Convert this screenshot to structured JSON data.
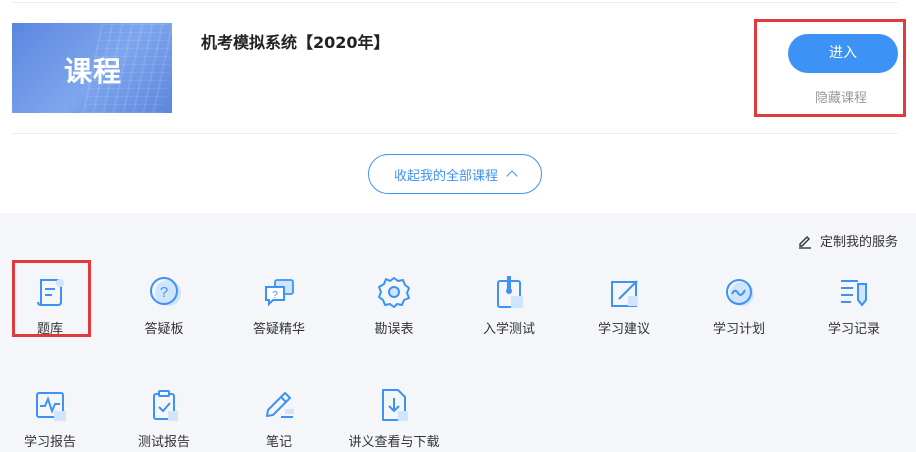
{
  "course": {
    "thumbnail_text": "课程",
    "title": "机考模拟系统【2020年】",
    "enter_label": "进入",
    "hide_label": "隐藏课程"
  },
  "collapse": {
    "label": "收起我的全部课程"
  },
  "services": {
    "customize_label": "定制我的服务",
    "items": [
      {
        "label": "题库",
        "icon": "question-bank-icon"
      },
      {
        "label": "答疑板",
        "icon": "question-mark-icon"
      },
      {
        "label": "答疑精华",
        "icon": "chat-bubbles-icon"
      },
      {
        "label": "勘误表",
        "icon": "gear-icon"
      },
      {
        "label": "入学测试",
        "icon": "clipboard-pin-icon"
      },
      {
        "label": "学习建议",
        "icon": "edit-box-icon"
      },
      {
        "label": "学习计划",
        "icon": "wave-circle-icon"
      },
      {
        "label": "学习记录",
        "icon": "list-pen-icon"
      },
      {
        "label": "学习报告",
        "icon": "pulse-chart-icon"
      },
      {
        "label": "测试报告",
        "icon": "clipboard-check-icon"
      },
      {
        "label": "笔记",
        "icon": "pencil-icon"
      },
      {
        "label": "讲义查看与下载",
        "icon": "download-doc-icon"
      }
    ]
  },
  "colors": {
    "accent": "#3d93f5",
    "highlight": "#e0393e",
    "panel_bg": "#f4f6f9"
  }
}
